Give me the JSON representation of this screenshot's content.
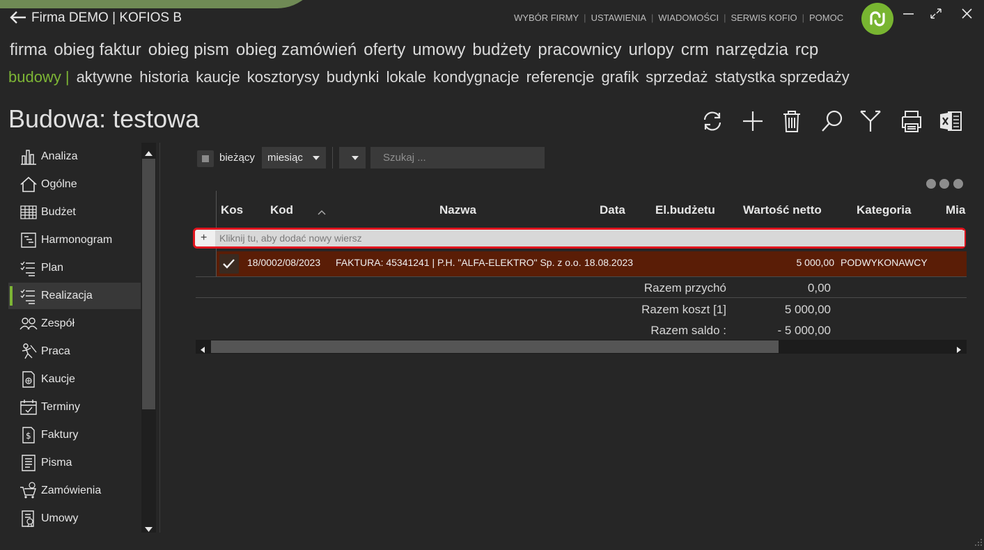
{
  "window": {
    "title": "Firma DEMO | KOFIOS B",
    "top_nav": [
      "WYBÓR FIRMY",
      "USTAWIENIA",
      "WIADOMOŚCI",
      "SERWIS KOFIO",
      "POMOC"
    ],
    "logo_color": "#78b531"
  },
  "menu_main": [
    "firma",
    "obieg faktur",
    "obieg pism",
    "obieg zamówień",
    "oferty",
    "umowy",
    "budżety",
    "pracownicy",
    "urlopy",
    "crm",
    "narzędzia",
    "rcp"
  ],
  "menu_sub": {
    "active": "budowy",
    "separator": "|",
    "items": [
      "aktywne",
      "historia",
      "kaucje",
      "kosztorysy",
      "budynki",
      "lokale",
      "kondygnacje",
      "referencje",
      "grafik",
      "sprzedaż",
      "statystka sprzedaży"
    ]
  },
  "page": {
    "title": "Budowa: testowa"
  },
  "toolbar_icons": [
    "refresh-icon",
    "add-icon",
    "delete-icon",
    "search-icon",
    "filter-icon",
    "print-icon",
    "excel-icon"
  ],
  "sidebar": {
    "active_index": 5,
    "accent": "#7db535",
    "items": [
      {
        "label": "Analiza",
        "icon": "bar-chart-icon"
      },
      {
        "label": "Ogólne",
        "icon": "home-icon"
      },
      {
        "label": "Budżet",
        "icon": "table-grid-icon"
      },
      {
        "label": "Harmonogram",
        "icon": "schedule-icon"
      },
      {
        "label": "Plan",
        "icon": "list-check-icon"
      },
      {
        "label": "Realizacja",
        "icon": "list-check-icon"
      },
      {
        "label": "Zespół",
        "icon": "team-icon"
      },
      {
        "label": "Praca",
        "icon": "worker-icon"
      },
      {
        "label": "Kaucje",
        "icon": "deposit-icon"
      },
      {
        "label": "Terminy",
        "icon": "calendar-icon"
      },
      {
        "label": "Faktury",
        "icon": "invoice-icon"
      },
      {
        "label": "Pisma",
        "icon": "document-icon"
      },
      {
        "label": "Zamówienia",
        "icon": "cart-icon"
      },
      {
        "label": "Umowy",
        "icon": "contract-icon"
      }
    ]
  },
  "filters": {
    "current_label": "bieżący",
    "period_value": "miesiąc",
    "search_placeholder": "Szukaj ..."
  },
  "grid": {
    "columns": [
      "Kos",
      "Kod",
      "Nazwa",
      "Data",
      "El.budżetu",
      "Wartość netto",
      "Kategoria",
      "Mia"
    ],
    "new_row_text": "Kliknij tu, aby dodać nowy wiersz",
    "rows": [
      {
        "kod": "18/0002/08/2023",
        "nazwa": "FAKTURA: 45341241 | P.H. \"ALFA-ELEKTRO\" Sp. z o.o.",
        "data": "18.08.2023",
        "wartosc": "5 000,00",
        "kategoria": "PODWYKONAWCY"
      }
    ],
    "row_color": "#5a1d06",
    "highlight_color": "#e0141e",
    "summary": [
      {
        "label": "Razem przychó",
        "value": "0,00"
      },
      {
        "label": "Razem koszt [1]",
        "value": "5 000,00"
      },
      {
        "label": "Razem saldo :",
        "value": "- 5 000,00"
      }
    ]
  }
}
